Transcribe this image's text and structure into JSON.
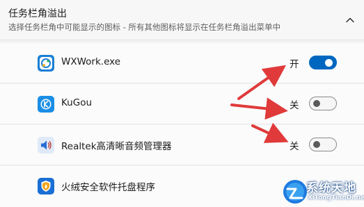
{
  "header": {
    "title": "任务栏角溢出",
    "subtitle": "选择任务栏角中可能显示的图标 - 所有其他图标将显示在任务栏角溢出菜单中",
    "collapse_icon": "chevron-up-icon"
  },
  "apps": [
    {
      "name": "WXWork.exe",
      "state_label": "开",
      "toggle_on": true,
      "icon": "wxwork-icon",
      "icon_color": "#1a7fd4"
    },
    {
      "name": "KuGou",
      "state_label": "关",
      "toggle_on": false,
      "icon": "kugou-icon",
      "icon_color": "#1a8ee6"
    },
    {
      "name": "Realtek高清晰音频管理器",
      "state_label": "关",
      "toggle_on": false,
      "icon": "speaker-icon",
      "icon_color": "#2a6fd6"
    },
    {
      "name": "火绒安全软件托盘程序",
      "state_label": "",
      "toggle_on": null,
      "icon": "huorong-shield-icon",
      "icon_color": "#e8a01c"
    }
  ],
  "colors": {
    "accent": "#0067c0",
    "annotation_arrow": "#e03a3a"
  },
  "watermark": {
    "text": "系统天地",
    "sub": "XiTongTianDi.net"
  }
}
